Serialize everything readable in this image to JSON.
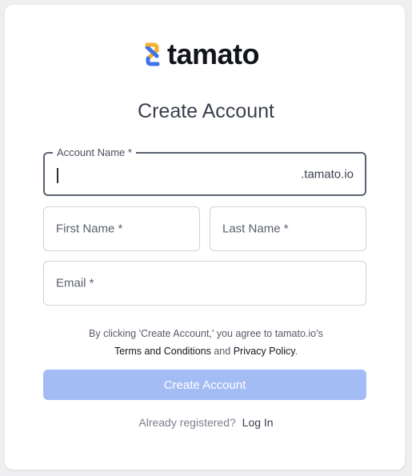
{
  "brand": {
    "name": "tamato",
    "logo_icon": "tamato-logo-icon"
  },
  "page": {
    "title": "Create Account"
  },
  "form": {
    "account_name": {
      "label": "Account Name *",
      "value": "",
      "suffix": ".tamato.io"
    },
    "first_name": {
      "label": "First Name *"
    },
    "last_name": {
      "label": "Last Name *"
    },
    "email": {
      "label": "Email *"
    }
  },
  "agreement": {
    "prefix": "By clicking 'Create Account,' you agree to tamato.io’s",
    "terms_link": "Terms and Conditions",
    "and": "and",
    "privacy_link": "Privacy Policy",
    "period": "."
  },
  "submit": {
    "label": "Create Account",
    "color": "#a4bcf4"
  },
  "footer": {
    "prompt": "Already registered?",
    "login_link": "Log In"
  }
}
